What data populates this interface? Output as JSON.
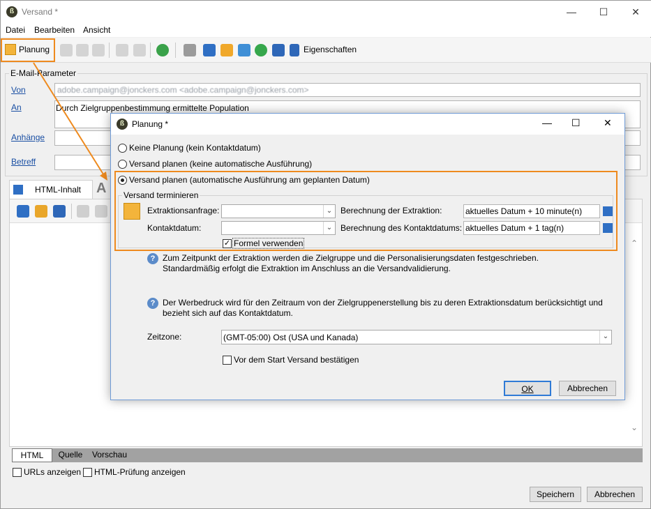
{
  "window": {
    "title": "Versand *",
    "minimize": "—",
    "maximize": "☐",
    "close": "✕"
  },
  "menu": [
    "Datei",
    "Bearbeiten",
    "Ansicht"
  ],
  "toolbar": {
    "planung": "Planung",
    "eigenschaften": "Eigenschaften"
  },
  "email_params": {
    "legend": "E-Mail-Parameter",
    "von_label": "Von",
    "von_value": "adobe.campaign@jonckers.com <adobe.campaign@jonckers.com>",
    "an_label": "An",
    "an_value": "Durch Zielgruppenbestimmung ermittelte Population",
    "anhaenge_label": "Anhänge",
    "betreff_label": "Betreff"
  },
  "content_tabs": {
    "html_inhalt": "HTML-Inhalt",
    "text_icon": "A"
  },
  "bottom_tabs": [
    "HTML",
    "Quelle",
    "Vorschau"
  ],
  "options": {
    "urls": "URLs anzeigen",
    "html_pruefung": "HTML-Prüfung anzeigen"
  },
  "footer": {
    "save": "Speichern",
    "cancel": "Abbrechen"
  },
  "dialog": {
    "title": "Planung *",
    "radio1": "Keine Planung (kein Kontaktdatum)",
    "radio2": "Versand planen (keine automatische Ausführung)",
    "radio3": "Versand planen (automatische Ausführung am geplanten Datum)",
    "group": "Versand terminieren",
    "extraktionsanfrage": "Extraktionsanfrage:",
    "kontaktdatum": "Kontaktdatum:",
    "berechnung_extraktion": "Berechnung der Extraktion:",
    "berechnung_extraktion_value": "aktuelles Datum + 10 minute(n)",
    "berechnung_kontakt": "Berechnung des Kontaktdatums:",
    "berechnung_kontakt_value": "aktuelles Datum + 1 tag(n)",
    "formel": "Formel verwenden",
    "info1_l1": "Zum Zeitpunkt der Extraktion werden die Zielgruppe und die Personalisierungsdaten festgeschrieben.",
    "info1_l2": "Standardmäßig erfolgt die Extraktion im Anschluss an die Versandvalidierung.",
    "info2_l1": "Der Werbedruck wird für den Zeitraum von der Zielgruppenerstellung bis zu deren Extraktionsdatum berücksichtigt und",
    "info2_l2": "bezieht sich auf das Kontaktdatum.",
    "zeitzone_label": "Zeitzone:",
    "zeitzone_value": "(GMT-05:00) Ost (USA und Kanada)",
    "bestaetigen": "Vor dem Start Versand bestätigen",
    "ok": "OK",
    "abbrechen": "Abbrechen"
  }
}
